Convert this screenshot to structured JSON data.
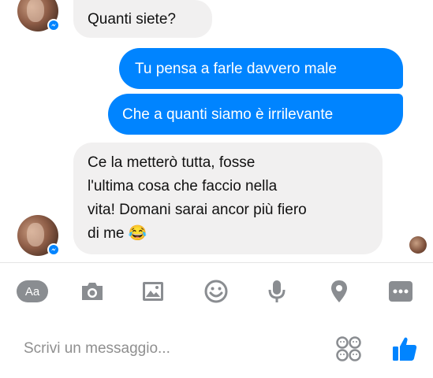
{
  "messages": {
    "incoming_1": "Quanti siete?",
    "outgoing_1": "Tu pensa a farle davvero male",
    "outgoing_2": "Che a quanti siamo è irrilevante",
    "incoming_2_lines": [
      "Ce la metterò tutta, fosse",
      "l'ultima cosa che faccio nella",
      "vita! Domani sarai ancor più fiero",
      "di me 😂"
    ]
  },
  "composer": {
    "aa_label": "Aa",
    "placeholder": "Scrivi un messaggio..."
  },
  "icons": {
    "aa": "text-format-icon",
    "camera": "camera-icon",
    "image": "image-icon",
    "emoji": "smiley-icon",
    "mic": "microphone-icon",
    "location": "location-pin-icon",
    "more": "more-icon",
    "stickers": "sticker-icon",
    "like": "thumbs-up-icon"
  },
  "colors": {
    "outgoing_bubble": "#0084ff",
    "incoming_bubble": "#f1f0f0",
    "icon_gray": "#8a8d91",
    "like_blue": "#0084ff"
  }
}
